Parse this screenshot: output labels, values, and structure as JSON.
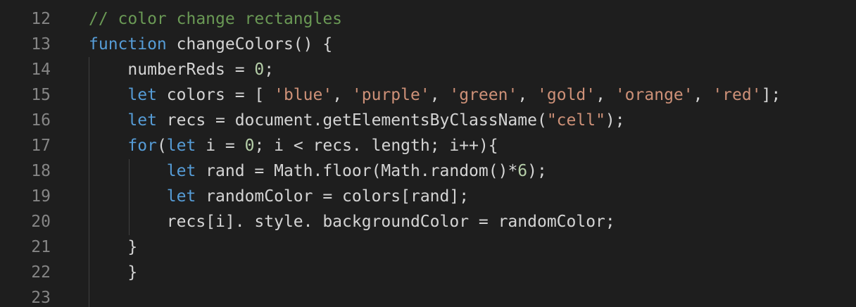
{
  "editor": {
    "theme_colors": {
      "background": "#1e1e1e",
      "line_number": "#858585",
      "default_text": "#d4d4d4",
      "keyword": "#569cd6",
      "string": "#ce9178",
      "number": "#b5cea8",
      "comment": "#6a9955",
      "indent_guide": "#404040"
    },
    "lines": [
      {
        "number": "12",
        "tokens": [
          {
            "t": "cmt",
            "v": "// color change rectangles"
          }
        ]
      },
      {
        "number": "13",
        "tokens": [
          {
            "t": "kw",
            "v": "function"
          },
          {
            "t": "txt",
            "v": " changeColors() {"
          }
        ]
      },
      {
        "number": "14",
        "tokens": [
          {
            "t": "txt",
            "v": "    numberReds = "
          },
          {
            "t": "num",
            "v": "0"
          },
          {
            "t": "txt",
            "v": ";"
          }
        ]
      },
      {
        "number": "15",
        "tokens": [
          {
            "t": "txt",
            "v": "    "
          },
          {
            "t": "kw",
            "v": "let"
          },
          {
            "t": "txt",
            "v": " colors = [ "
          },
          {
            "t": "str",
            "v": "'blue'"
          },
          {
            "t": "txt",
            "v": ", "
          },
          {
            "t": "str",
            "v": "'purple'"
          },
          {
            "t": "txt",
            "v": ", "
          },
          {
            "t": "str",
            "v": "'green'"
          },
          {
            "t": "txt",
            "v": ", "
          },
          {
            "t": "str",
            "v": "'gold'"
          },
          {
            "t": "txt",
            "v": ", "
          },
          {
            "t": "str",
            "v": "'orange'"
          },
          {
            "t": "txt",
            "v": ", "
          },
          {
            "t": "str",
            "v": "'red'"
          },
          {
            "t": "txt",
            "v": "];"
          }
        ]
      },
      {
        "number": "16",
        "tokens": [
          {
            "t": "txt",
            "v": "    "
          },
          {
            "t": "kw",
            "v": "let"
          },
          {
            "t": "txt",
            "v": " recs = document.getElementsByClassName("
          },
          {
            "t": "str",
            "v": "\"cell\""
          },
          {
            "t": "txt",
            "v": ");"
          }
        ]
      },
      {
        "number": "17",
        "tokens": [
          {
            "t": "txt",
            "v": "    "
          },
          {
            "t": "kw",
            "v": "for"
          },
          {
            "t": "txt",
            "v": "("
          },
          {
            "t": "kw",
            "v": "let"
          },
          {
            "t": "txt",
            "v": " i = "
          },
          {
            "t": "num",
            "v": "0"
          },
          {
            "t": "txt",
            "v": "; i < recs. length; i++){"
          }
        ]
      },
      {
        "number": "18",
        "tokens": [
          {
            "t": "txt",
            "v": "        "
          },
          {
            "t": "kw",
            "v": "let"
          },
          {
            "t": "txt",
            "v": " rand = Math.floor(Math.random()*"
          },
          {
            "t": "num",
            "v": "6"
          },
          {
            "t": "txt",
            "v": ");"
          }
        ]
      },
      {
        "number": "19",
        "tokens": [
          {
            "t": "txt",
            "v": "        "
          },
          {
            "t": "kw",
            "v": "let"
          },
          {
            "t": "txt",
            "v": " randomColor = colors[rand];"
          }
        ]
      },
      {
        "number": "20",
        "tokens": [
          {
            "t": "txt",
            "v": "        recs[i]. style. backgroundColor = randomColor;"
          }
        ]
      },
      {
        "number": "21",
        "tokens": [
          {
            "t": "txt",
            "v": "    }"
          }
        ]
      },
      {
        "number": "22",
        "tokens": [
          {
            "t": "txt",
            "v": "    }"
          }
        ]
      },
      {
        "number": "23",
        "tokens": []
      }
    ]
  }
}
